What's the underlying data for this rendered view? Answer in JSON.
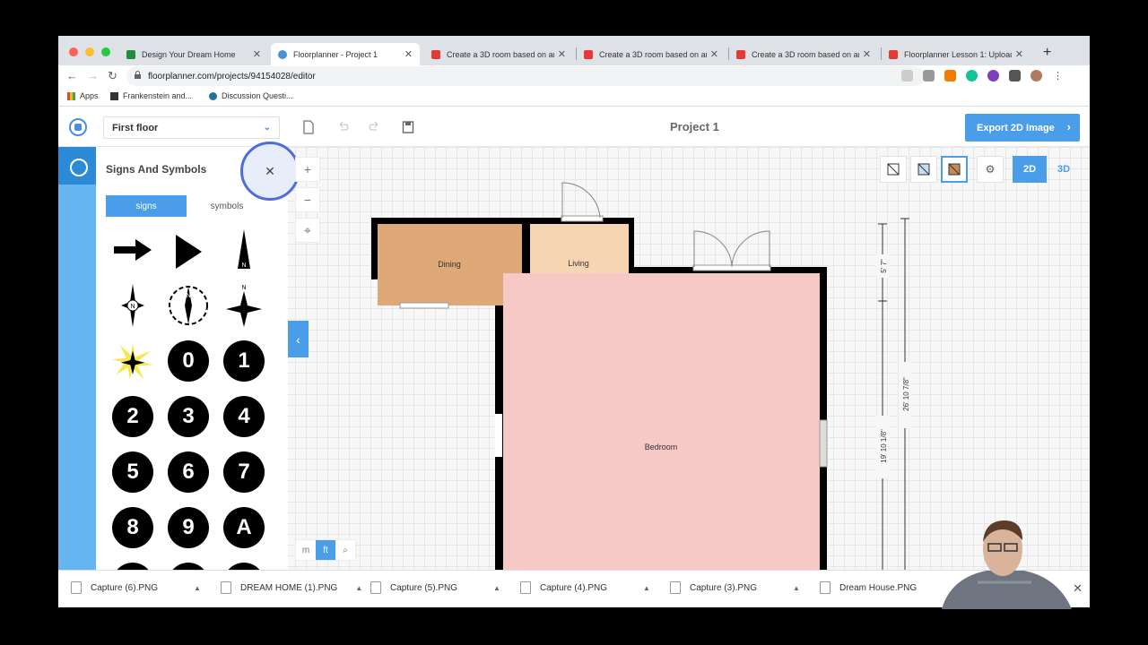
{
  "browser": {
    "tabs": [
      {
        "title": "Design Your Dream Home",
        "color": "#1e8e3e"
      },
      {
        "title": "Floorplanner - Project 1",
        "color": "#4a90d9"
      },
      {
        "title": "Create a 3D room based on an",
        "color": "#e53935"
      },
      {
        "title": "Create a 3D room based on an",
        "color": "#e53935"
      },
      {
        "title": "Create a 3D room based on an",
        "color": "#e53935"
      },
      {
        "title": "Floorplanner Lesson 1: Upload",
        "color": "#e53935"
      }
    ],
    "close_glyph": "✕",
    "new_tab_glyph": "+",
    "url": "floorplanner.com/projects/94154028/editor",
    "bookmarks": [
      "Apps",
      "Frankenstein and...",
      "Discussion Questi..."
    ]
  },
  "app": {
    "floor_select": "First floor",
    "project_title": "Project 1",
    "export_label": "Export 2D Image"
  },
  "panel": {
    "title": "Signs And Symbols",
    "tab_signs": "signs",
    "tab_symbols": "symbols",
    "number_symbols": [
      "0",
      "1",
      "2",
      "3",
      "4",
      "5",
      "6",
      "7",
      "8",
      "9",
      "A"
    ]
  },
  "view": {
    "unit_m": "m",
    "unit_ft": "ft",
    "mode_2d": "2D",
    "mode_3d": "3D"
  },
  "plan": {
    "rooms": [
      {
        "name": "Dining",
        "color": "#dfa877"
      },
      {
        "name": "Living",
        "color": "#f7d4b2"
      },
      {
        "name": "Bedroom",
        "color": "#f6c8c6"
      }
    ],
    "dimensions": [
      "5' 7\"",
      "26' 10 7/8\"",
      "19' 10 1/8\""
    ]
  },
  "downloads": [
    "Capture (6).PNG",
    "DREAM HOME (1).PNG",
    "Capture (5).PNG",
    "Capture (4).PNG",
    "Capture (3).PNG",
    "Dream House.PNG"
  ]
}
